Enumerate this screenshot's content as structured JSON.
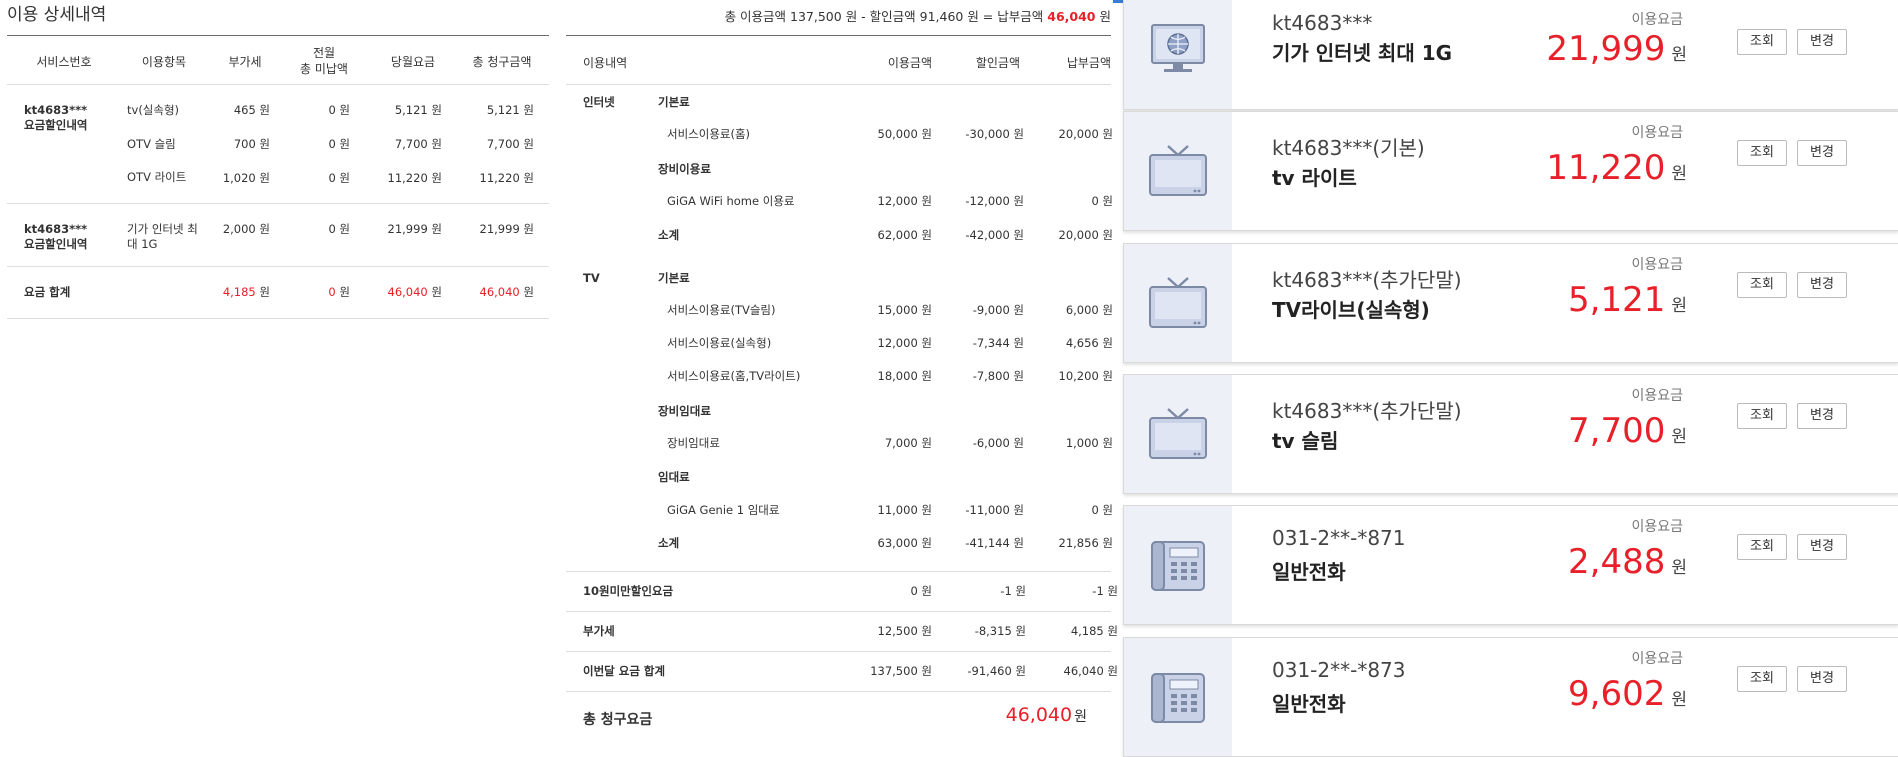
{
  "left": {
    "title": "이용 상세내역",
    "headers": [
      "서비스번호",
      "이용항목",
      "부가세",
      "전월",
      "총 미납액",
      "당월요금",
      "총 청구금액"
    ],
    "group1": {
      "svc_line1": "kt4683***",
      "svc_line2": "요금할인내역",
      "rows": [
        {
          "item": "tv(실속형)",
          "vat": "465 원",
          "unpaid": "0 원",
          "month": "5,121 원",
          "total": "5,121 원"
        },
        {
          "item": "OTV 슬림",
          "vat": "700 원",
          "unpaid": "0 원",
          "month": "7,700 원",
          "total": "7,700 원"
        },
        {
          "item": "OTV 라이트",
          "vat": "1,020 원",
          "unpaid": "0 원",
          "month": "11,220 원",
          "total": "11,220 원"
        }
      ]
    },
    "group2": {
      "svc_line1": "kt4683***",
      "svc_line2": "요금할인내역",
      "item_line1": "기가 인터넷 최",
      "item_line2": "대 1G",
      "vat": "2,000 원",
      "unpaid": "0 원",
      "month": "21,999 원",
      "total": "21,999 원"
    },
    "sum": {
      "label": "요금 합계",
      "vat": "4,185",
      "unpaid": "0",
      "month": "46,040",
      "total": "46,040",
      "unit": "원"
    }
  },
  "mid": {
    "summary_prefix": "총 이용금액 137,500 원 - 할인금액 91,460 원 = 납부금액",
    "summary_total": "46,040",
    "summary_unit": "원",
    "headers": [
      "이용내역",
      "이용금액",
      "할인금액",
      "납부금액"
    ],
    "sections": {
      "internet": "인터넷",
      "tv": "TV"
    },
    "rows": [
      {
        "label": "기본료",
        "kind": "cat"
      },
      {
        "label": "서비스이용료(홈)",
        "use": "50,000 원",
        "disc": "-30,000 원",
        "pay": "20,000 원"
      },
      {
        "label": "장비이용료",
        "kind": "cat"
      },
      {
        "label": "GiGA WiFi home 이용료",
        "use": "12,000 원",
        "disc": "-12,000 원",
        "pay": "0 원"
      },
      {
        "label": "소계",
        "kind": "sub",
        "use": "62,000 원",
        "disc": "-42,000 원",
        "pay": "20,000 원"
      },
      {
        "label": "기본료",
        "kind": "cat"
      },
      {
        "label": "서비스이용료(TV슬림)",
        "use": "15,000 원",
        "disc": "-9,000 원",
        "pay": "6,000 원"
      },
      {
        "label": "서비스이용료(실속형)",
        "use": "12,000 원",
        "disc": "-7,344 원",
        "pay": "4,656 원"
      },
      {
        "label": "서비스이용료(홈,TV라이트)",
        "use": "18,000 원",
        "disc": "-7,800 원",
        "pay": "10,200 원"
      },
      {
        "label": "장비임대료",
        "kind": "cat"
      },
      {
        "label": "장비임대료",
        "use": "7,000 원",
        "disc": "-6,000 원",
        "pay": "1,000 원"
      },
      {
        "label": "임대료",
        "kind": "cat"
      },
      {
        "label": "GiGA Genie 1 임대료",
        "use": "11,000 원",
        "disc": "-11,000 원",
        "pay": "0 원"
      },
      {
        "label": "소계",
        "kind": "sub",
        "use": "63,000 원",
        "disc": "-41,144 원",
        "pay": "21,856 원"
      }
    ],
    "totals": [
      {
        "label": "10원미만할인요금",
        "use": "0 원",
        "disc": "-1 원",
        "pay": "-1 원"
      },
      {
        "label": "부가세",
        "use": "12,500 원",
        "disc": "-8,315 원",
        "pay": "4,185 원"
      },
      {
        "label": "이번달 요금 합계",
        "use": "137,500 원",
        "disc": "-91,460 원",
        "pay": "46,040 원"
      }
    ],
    "grand_label": "총 청구요금",
    "grand_value": "46,040",
    "grand_unit": "원"
  },
  "right": {
    "fee_label": "이용요금",
    "unit": "원",
    "btn_view": "조회",
    "btn_change": "변경",
    "cards": [
      {
        "icon": "globe-monitor-icon",
        "svc": "kt4683***",
        "name": "기가 인터넷 최대 1G",
        "fee": "21,999"
      },
      {
        "icon": "tv-icon",
        "svc": "kt4683***(기본)",
        "name": "tv 라이트",
        "fee": "11,220"
      },
      {
        "icon": "tv-icon",
        "svc": "kt4683***(추가단말)",
        "name": "TV라이브(실속형)",
        "fee": "5,121"
      },
      {
        "icon": "tv-icon",
        "svc": "kt4683***(추가단말)",
        "name": "tv 슬림",
        "fee": "7,700"
      },
      {
        "icon": "phone-icon",
        "svc": "031-2**-*871",
        "name": "일반전화",
        "fee": "2,488"
      },
      {
        "icon": "phone-icon",
        "svc": "031-2**-*873",
        "name": "일반전화",
        "fee": "9,602"
      }
    ],
    "accent": "#e8202a"
  }
}
